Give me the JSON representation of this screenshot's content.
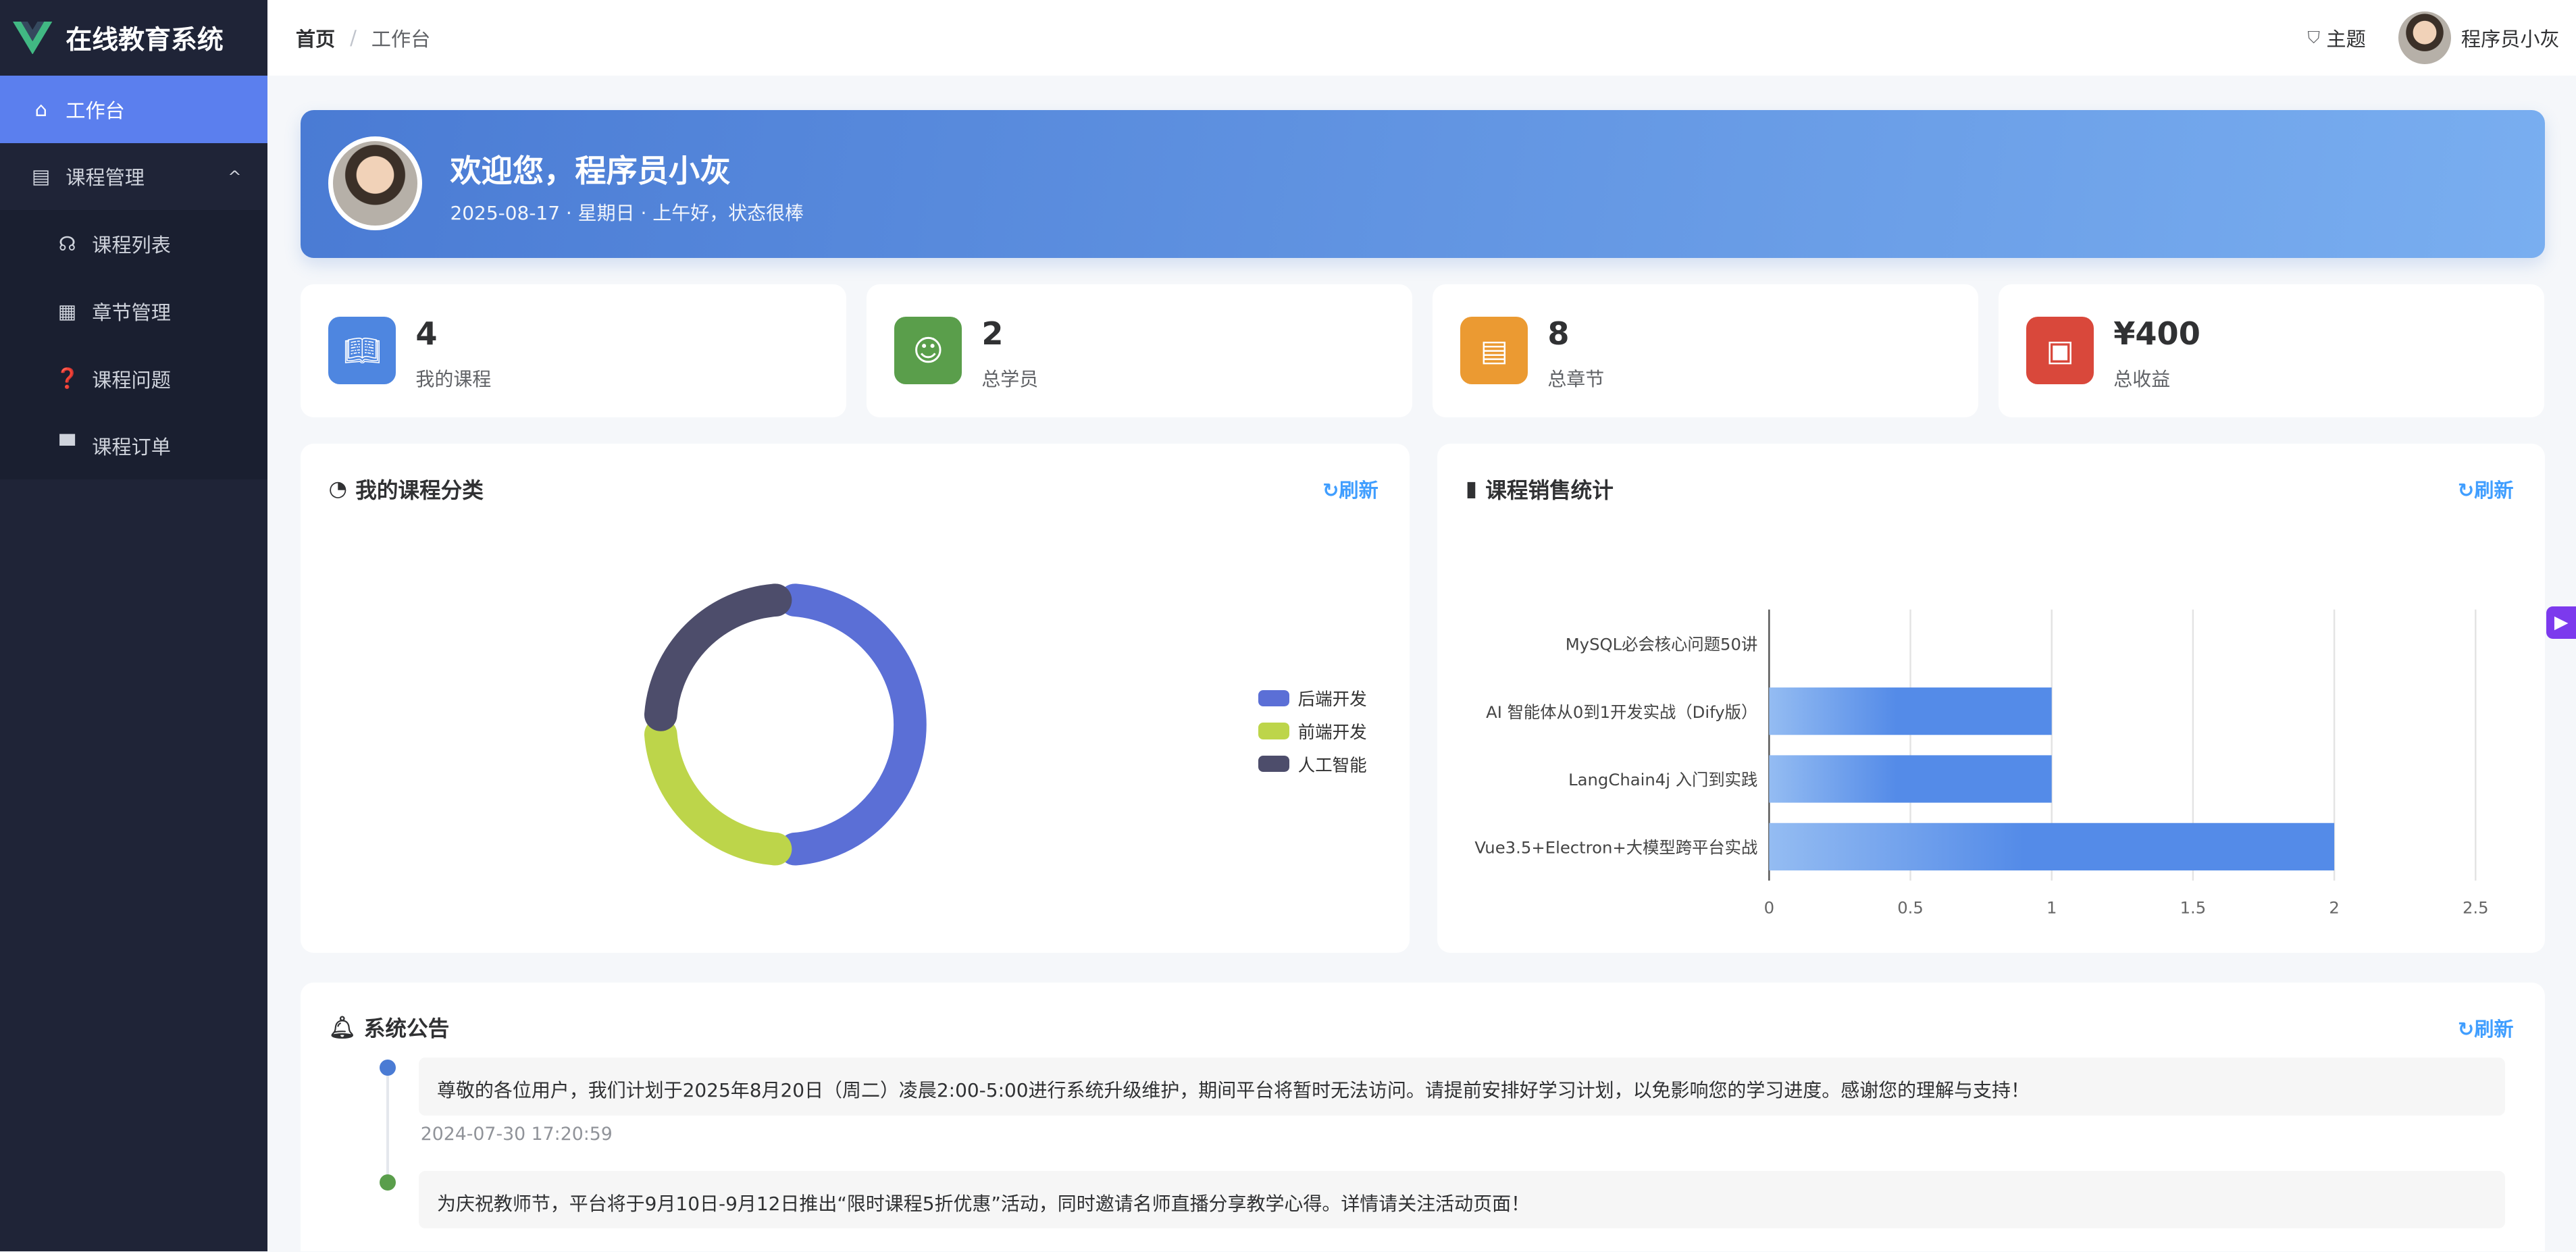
{
  "app": {
    "title": "在线教育系统"
  },
  "sidebar": {
    "items": [
      {
        "label": "工作台",
        "icon": "home-icon",
        "active": true
      },
      {
        "label": "课程管理",
        "icon": "document-icon",
        "expanded": true
      },
      {
        "label": "课程列表",
        "icon": "headset-icon"
      },
      {
        "label": "章节管理",
        "icon": "grid-icon"
      },
      {
        "label": "课程问题",
        "icon": "question-icon"
      },
      {
        "label": "课程订单",
        "icon": "printer-icon"
      }
    ]
  },
  "header": {
    "breadcrumb": [
      "首页",
      "工作台"
    ],
    "separator": "/",
    "theme_label": "主题",
    "user_name": "程序员小灰"
  },
  "banner": {
    "greeting": "欢迎您，程序员小灰",
    "subtitle": "2025-08-17 · 星期日 · 上午好，状态很棒"
  },
  "stats": [
    {
      "value": "4",
      "label": "我的课程",
      "color": "#4e86e0",
      "icon": "book-icon"
    },
    {
      "value": "2",
      "label": "总学员",
      "color": "#5a9e4b",
      "icon": "user-icon"
    },
    {
      "value": "8",
      "label": "总章节",
      "color": "#eb9a32",
      "icon": "file-icon"
    },
    {
      "value": "¥400",
      "label": "总收益",
      "color": "#d9483b",
      "icon": "money-icon"
    }
  ],
  "refresh_label": "刷新",
  "chart_data": [
    {
      "type": "pie",
      "title": "我的课程分类",
      "legend": "right",
      "categories": [
        "后端开发",
        "前端开发",
        "人工智能"
      ],
      "values": [
        2,
        1,
        1
      ],
      "colors": [
        "#5b6fd6",
        "#bdd54a",
        "#4d4d6b"
      ]
    },
    {
      "type": "bar",
      "orientation": "horizontal",
      "title": "课程销售统计",
      "categories": [
        "MySQL必会核心问题50讲",
        "AI 智能体从0到1开发实战（Dify版）",
        "LangChain4j 入门到实践",
        "Vue3.5+Electron+大模型跨平台实战"
      ],
      "values": [
        0,
        1,
        1,
        2
      ],
      "xlim": [
        0,
        2.5
      ],
      "xticks": [
        "0",
        "0.5",
        "1",
        "1.5",
        "2",
        "2.5"
      ],
      "grid": true,
      "color": "#548be8"
    }
  ],
  "announcements": {
    "title": "系统公告",
    "items": [
      {
        "text": "尊敬的各位用户，我们计划于2025年8月20日（周二）凌晨2:00-5:00进行系统升级维护，期间平台将暂时无法访问。请提前安排好学习计划，以免影响您的学习进度。感谢您的理解与支持！",
        "time": "2024-07-30 17:20:59",
        "color": "#4a7bd4"
      },
      {
        "text": "为庆祝教师节，平台将于9月10日-9月12日推出“限时课程5折优惠”活动，同时邀请名师直播分享教学心得。详情请关注活动页面！",
        "color": "#5a9e4b"
      }
    ]
  }
}
